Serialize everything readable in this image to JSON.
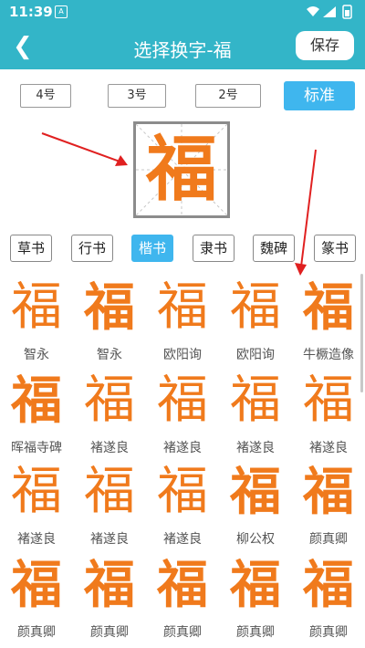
{
  "status_bar": {
    "time": "11:39",
    "notif_letter": "A"
  },
  "header": {
    "title": "选择换字-福",
    "back_label": "❮",
    "save_label": "保存"
  },
  "size_options": [
    "4号",
    "3号",
    "2号",
    "标准"
  ],
  "preview_char": "福",
  "style_tabs": [
    "草书",
    "行书",
    "楷书",
    "隶书",
    "魏碑",
    "篆书"
  ],
  "selected_style": "楷书",
  "samples": [
    {
      "char": "福",
      "author": "智永"
    },
    {
      "char": "福",
      "author": "智永"
    },
    {
      "char": "福",
      "author": "欧阳询"
    },
    {
      "char": "福",
      "author": "欧阳询"
    },
    {
      "char": "福",
      "author": "牛橛造像"
    },
    {
      "char": "福",
      "author": "晖福寺碑"
    },
    {
      "char": "福",
      "author": "褚遂良"
    },
    {
      "char": "福",
      "author": "褚遂良"
    },
    {
      "char": "福",
      "author": "褚遂良"
    },
    {
      "char": "福",
      "author": "褚遂良"
    },
    {
      "char": "福",
      "author": "褚遂良"
    },
    {
      "char": "福",
      "author": "褚遂良"
    },
    {
      "char": "福",
      "author": "褚遂良"
    },
    {
      "char": "福",
      "author": "柳公权"
    },
    {
      "char": "福",
      "author": "颜真卿"
    },
    {
      "char": "福",
      "author": "颜真卿"
    },
    {
      "char": "福",
      "author": "颜真卿"
    },
    {
      "char": "福",
      "author": "颜真卿"
    },
    {
      "char": "福",
      "author": "颜真卿"
    },
    {
      "char": "福",
      "author": "颜真卿"
    }
  ],
  "colors": {
    "accent": "#33b5c8",
    "selected": "#3fb6ee",
    "glyph": "#f07a1c",
    "arrow": "#e02020"
  }
}
